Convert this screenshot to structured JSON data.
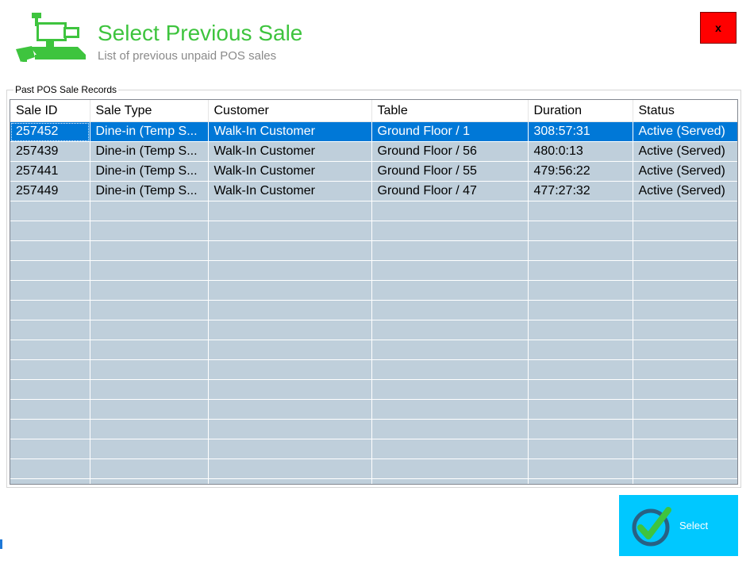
{
  "header": {
    "title": "Select Previous Sale",
    "subtitle": "List of previous unpaid POS sales",
    "icon": "pos-register-icon",
    "close_label": "x",
    "title_color": "#3ec43e",
    "close_color": "#ff0000"
  },
  "group": {
    "label": "Past POS Sale Records"
  },
  "table": {
    "columns": [
      "Sale ID",
      "Sale Type",
      "Customer",
      "Table",
      "Duration",
      "Status"
    ],
    "rows": [
      [
        "257452",
        "Dine-in (Temp S...",
        "Walk-In Customer",
        "Ground Floor / 1",
        "308:57:31",
        "Active (Served)"
      ],
      [
        "257439",
        "Dine-in (Temp S...",
        "Walk-In Customer",
        "Ground Floor / 56",
        "480:0:13",
        "Active (Served)"
      ],
      [
        "257441",
        "Dine-in (Temp S...",
        "Walk-In Customer",
        "Ground Floor / 55",
        "479:56:22",
        "Active (Served)"
      ],
      [
        "257449",
        "Dine-in (Temp S...",
        "Walk-In Customer",
        "Ground Floor / 47",
        "477:27:32",
        "Active (Served)"
      ]
    ],
    "selected_row": 0,
    "row_color": "#bfcfdb",
    "selected_color": "#0078d7"
  },
  "footer": {
    "select_label": "Select",
    "select_color": "#00c8ff",
    "select_icon": "checkmark-circle-icon"
  }
}
